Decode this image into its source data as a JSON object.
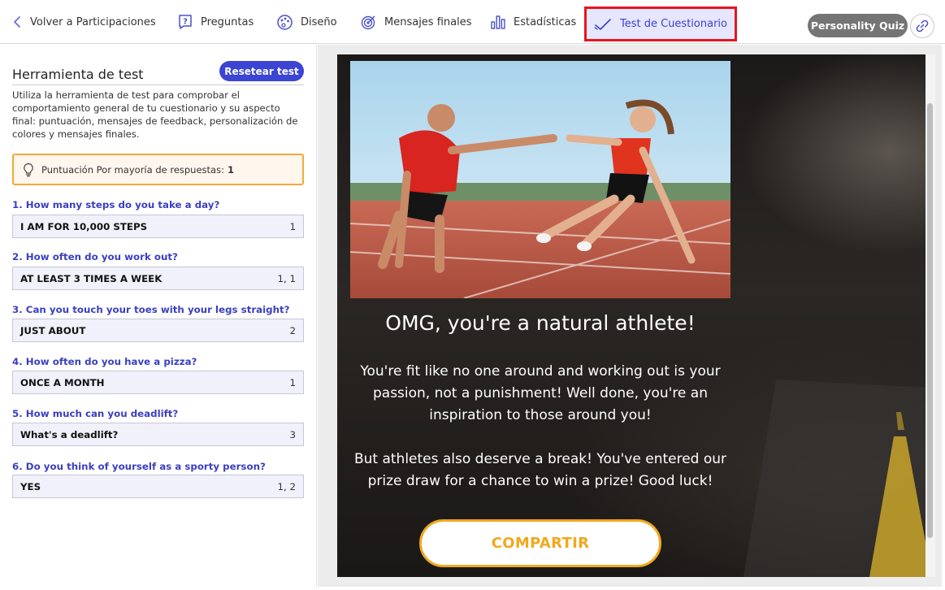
{
  "nav": {
    "back_label": "Volver a Participaciones",
    "preguntas_label": "Preguntas",
    "diseno_label": "Diseño",
    "mensajes_label": "Mensajes finales",
    "estadisticas_label": "Estadísticas",
    "test_label": "Test de Cuestionario",
    "quiz_type": "Personality Quiz",
    "active_tab": "Test de Cuestionario",
    "highlight_color": "#e8141c"
  },
  "tool": {
    "title": "Herramienta de test",
    "reset_label": "Resetear test",
    "description": "Utiliza la herramienta de test para comprobar el comportamiento general de tu cuestionario y su aspecto final: puntuación, mensajes de feedback, personalización de colores y mensajes finales.",
    "score_label": "Puntuación Por mayoría de respuestas:",
    "score_value": "1"
  },
  "questions": [
    {
      "label": "1. How many steps do you take a day?",
      "answer": "I AM FOR 10,000 STEPS",
      "score": "1"
    },
    {
      "label": "2. How often do you work out?",
      "answer": "AT LEAST 3 TIMES A WEEK",
      "score": "1, 1"
    },
    {
      "label": "3. Can you touch your toes with your legs straight?",
      "answer": "JUST ABOUT",
      "score": "2"
    },
    {
      "label": "4. How often do you have a pizza?",
      "answer": "ONCE A MONTH",
      "score": "1"
    },
    {
      "label": "5. How much can you deadlift?",
      "answer": "What's a deadlift?",
      "score": "3"
    },
    {
      "label": "6. Do you think of yourself as a sporty person?",
      "answer": "YES",
      "score": "1, 2"
    }
  ],
  "preview": {
    "title": "OMG, you're a natural athlete!",
    "paragraph1": "You're fit like no one around and working out is your passion, not a punishment! Well done, you're an inspiration to those around you!",
    "paragraph2": "But athletes also deserve a break! You've entered our prize draw for a chance to win a prize! Good luck!",
    "share_label": "COMPARTIR",
    "accent_color": "#f2a81d"
  }
}
